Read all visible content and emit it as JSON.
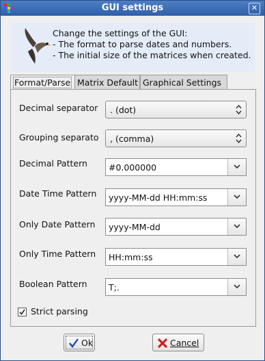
{
  "window": {
    "title": "GUI settings"
  },
  "header": {
    "line1": "Change the settings of the GUI:",
    "line2": "- The format to parse dates and numbers.",
    "line3": "- The initial size of the matrices when created."
  },
  "tabs": [
    {
      "label": "Format/Parse",
      "active": true
    },
    {
      "label": "Matrix Default",
      "active": false
    },
    {
      "label": "Graphical Settings",
      "active": false
    }
  ],
  "form": {
    "decimal_separator": {
      "label": "Decimal separator",
      "value": ". (dot)"
    },
    "grouping_separator": {
      "label": "Grouping separato",
      "value": ", (comma)"
    },
    "decimal_pattern": {
      "label": "Decimal Pattern",
      "value": "#0.000000"
    },
    "date_time_pattern": {
      "label": "Date Time Pattern",
      "value": "yyyy-MM-dd HH:mm:ss"
    },
    "only_date_pattern": {
      "label": "Only Date Pattern",
      "value": "yyyy-MM-dd"
    },
    "only_time_pattern": {
      "label": "Only Time Pattern",
      "value": "HH:mm:ss"
    },
    "boolean_pattern": {
      "label": "Boolean Pattern",
      "value": "T;."
    },
    "strict_parsing": {
      "label": "Strict parsing",
      "checked": true
    }
  },
  "buttons": {
    "ok": "Ok",
    "cancel": "Cancel"
  },
  "colors": {
    "titlebar": "#2e5fa8",
    "header_bg": "#e4ecf8",
    "cancel_icon": "#cc2020",
    "ok_icon": "#2050a0"
  }
}
